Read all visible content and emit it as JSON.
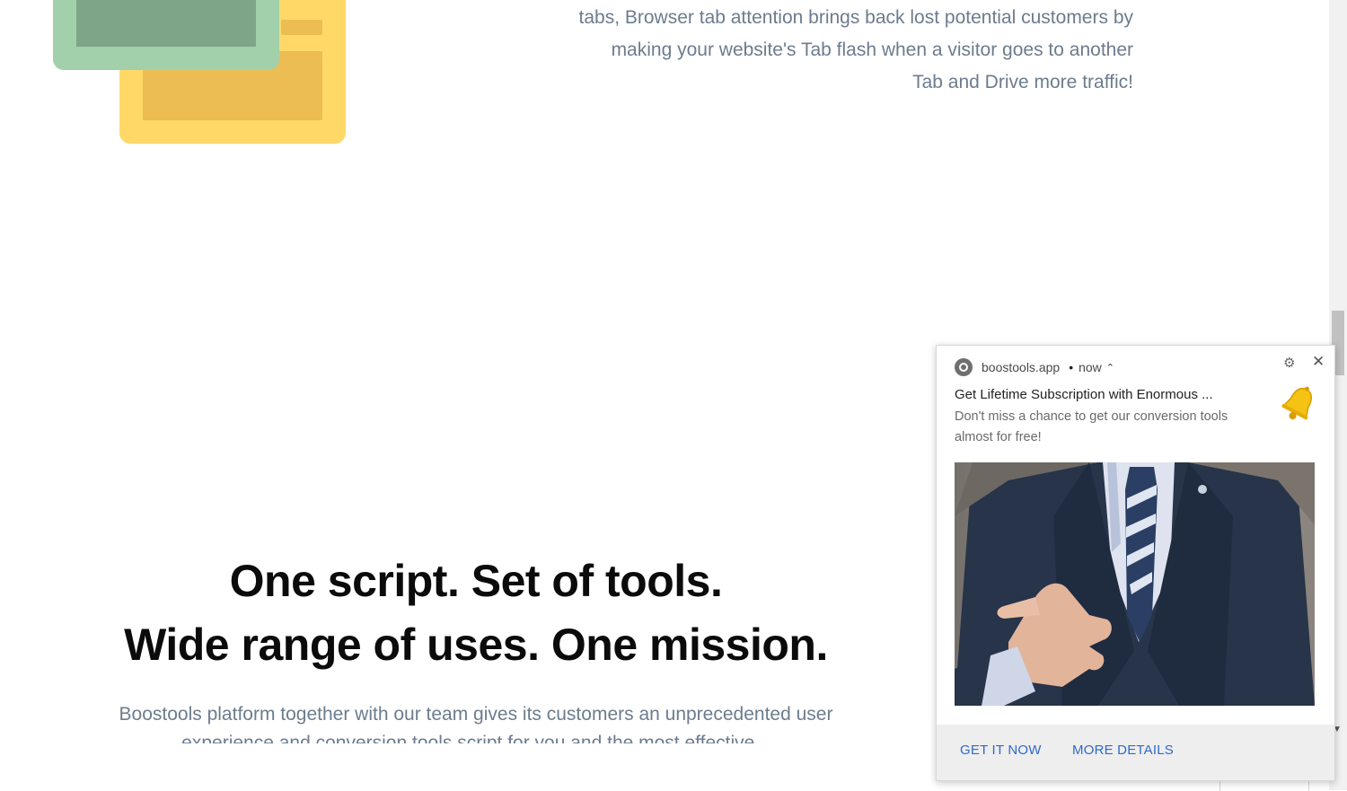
{
  "page": {
    "feature_paragraph": "tabs, Browser tab attention brings back lost potential customers by making your website's Tab flash when a visitor goes to another Tab and Drive more traffic!",
    "headline_line1": "One script. Set of tools.",
    "headline_line2": "Wide range of uses. One mission.",
    "intro_paragraph": "Boostools platform together with our team gives its customers an unprecedented user experience and conversion tools script for you and the most effective... "
  },
  "notification": {
    "site": "boostools.app",
    "time": "now",
    "title": "Get Lifetime Subscription with Enormous ...",
    "body": "Don't miss a chance to get our conversion tools almost for free!",
    "actions": [
      "GET IT NOW",
      "MORE DETAILS"
    ],
    "icons": {
      "browser": "chrome-icon",
      "settings": "gear-icon",
      "close": "close-icon",
      "expand": "chevron-up-icon",
      "badge": "bell-icon"
    }
  },
  "colors": {
    "body_text": "#6c7c8e",
    "headline": "#0b0b0b",
    "action_link": "#2f6ac9",
    "illus_yellow": "#ffd868",
    "illus_green": "#a1d0aa"
  }
}
